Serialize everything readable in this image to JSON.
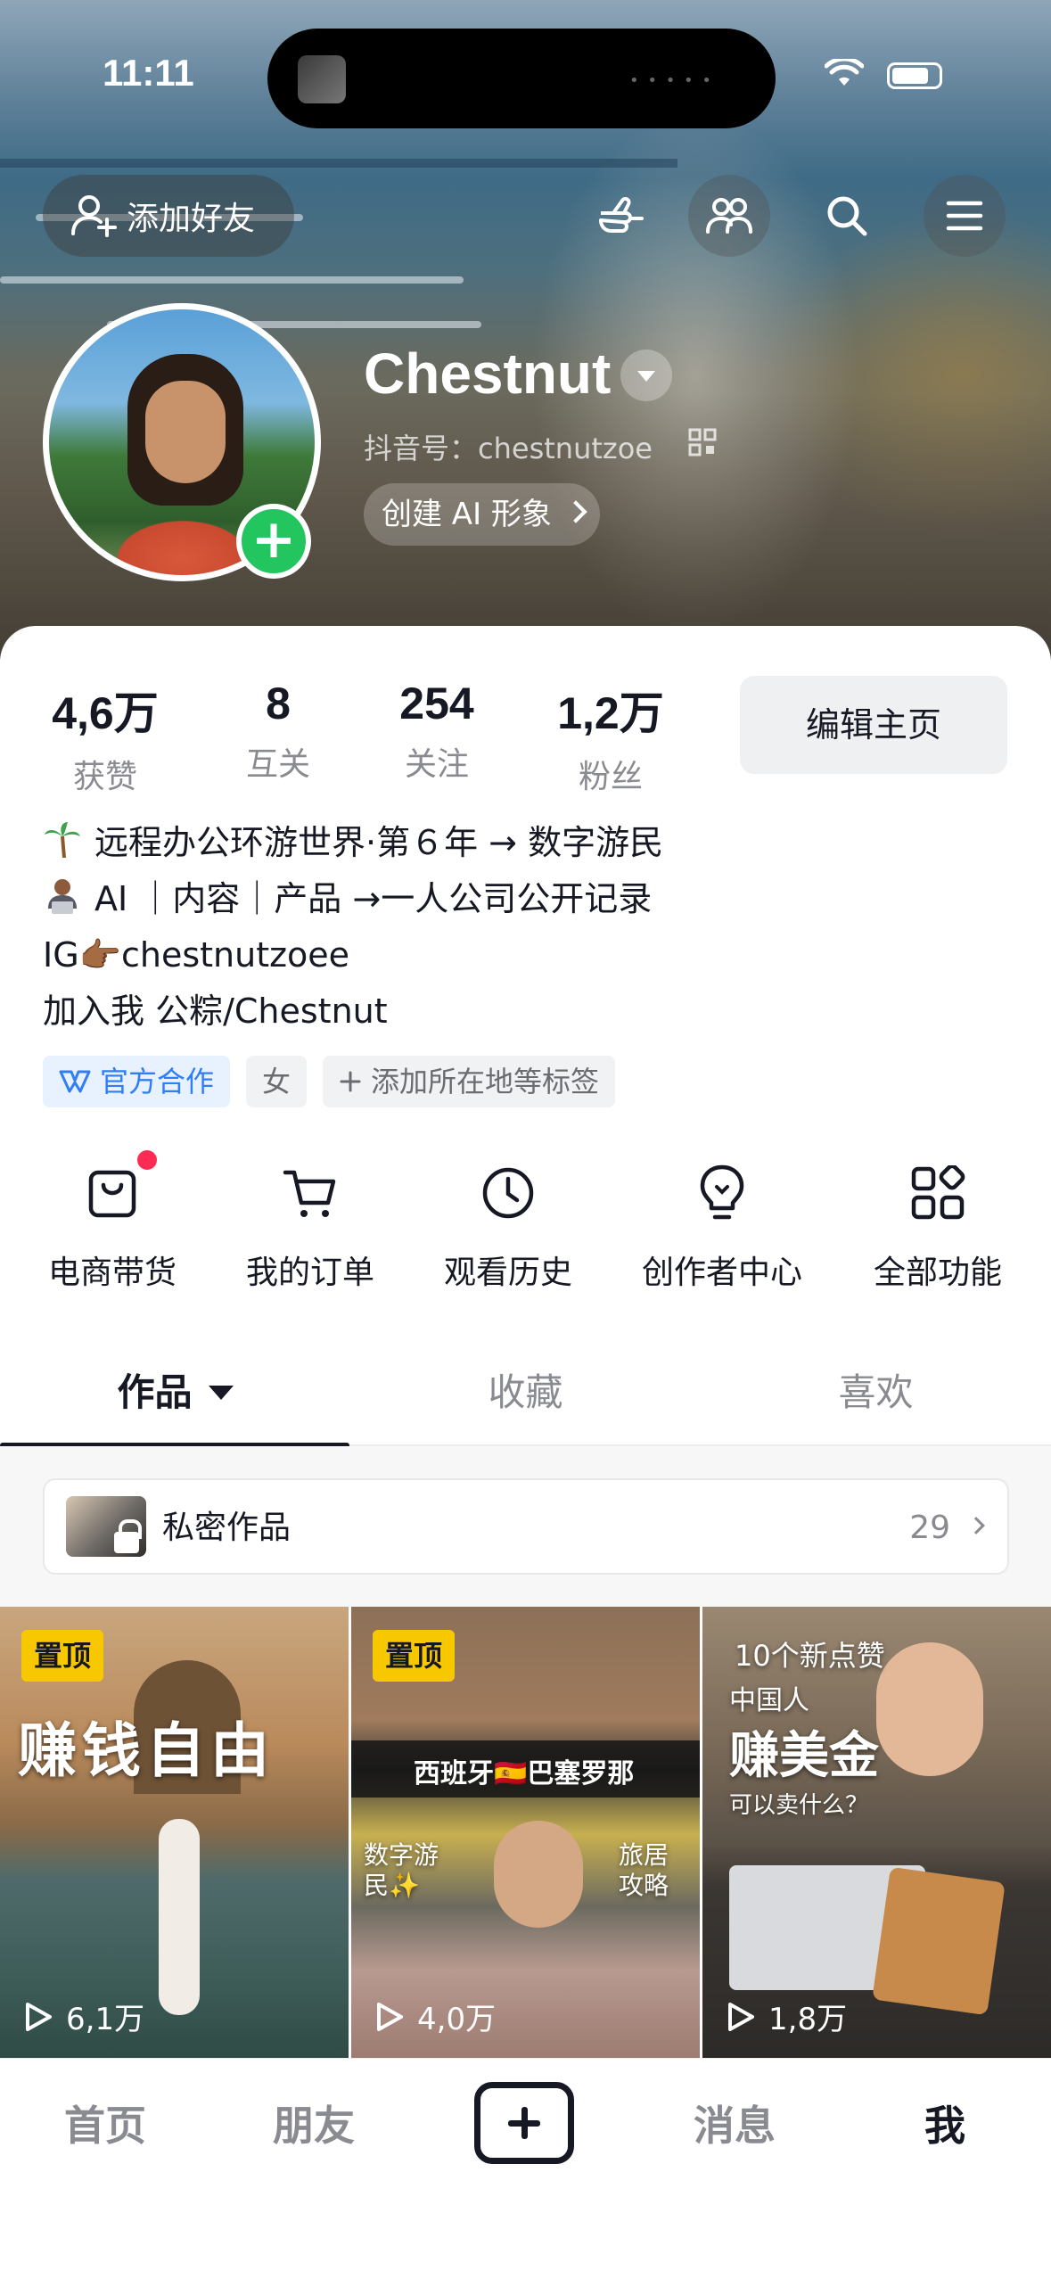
{
  "status_bar": {
    "time": "11:11"
  },
  "top_bar": {
    "add_friend_label": "添加好友"
  },
  "profile": {
    "nickname": "Chestnut",
    "douyin_id": "抖音号：chestnutzoe",
    "ai_avatar_label": "创建 AI 形象"
  },
  "stats": [
    {
      "value": "4,6万",
      "label": "获赞"
    },
    {
      "value": "8",
      "label": "互关"
    },
    {
      "value": "254",
      "label": "关注"
    },
    {
      "value": "1,2万",
      "label": "粉丝"
    }
  ],
  "edit_button_label": "编辑主页",
  "bio": {
    "line1": "远程办公环游世界·第６年 → 数字游民",
    "line2": "AI ｜内容｜产品 →一人公司公开记录",
    "line3": "IG👉🏾chestnutzoee",
    "line4": "加入我 公粽/Chestnut"
  },
  "tags": {
    "official": "官方合作",
    "gender": "女",
    "add_location": "添加所在地等标签"
  },
  "shortcuts": [
    {
      "label": "电商带货",
      "icon": "shopping-bag-icon"
    },
    {
      "label": "我的订单",
      "icon": "cart-icon"
    },
    {
      "label": "观看历史",
      "icon": "clock-icon"
    },
    {
      "label": "创作者中心",
      "icon": "lightbulb-icon"
    },
    {
      "label": "全部功能",
      "icon": "grid-icon"
    }
  ],
  "tabs": [
    {
      "label": "作品"
    },
    {
      "label": "收藏"
    },
    {
      "label": "喜欢"
    }
  ],
  "private_works": {
    "label": "私密作品",
    "count": "29"
  },
  "videos": [
    {
      "pinned": "置顶",
      "title": "赚钱自由",
      "views": "6,1万"
    },
    {
      "pinned": "置顶",
      "title": "西班牙🇪🇸巴塞罗那",
      "caption_left": "数字游民✨",
      "caption_right": "旅居攻略",
      "views": "4,0万"
    },
    {
      "badge": "10个新点赞",
      "caption_top": "中国人",
      "title": "赚美金",
      "caption_bottom": "可以卖什么？",
      "views": "1,8万"
    }
  ],
  "bottom_nav": [
    {
      "label": "首页"
    },
    {
      "label": "朋友"
    },
    {
      "label": "消息"
    },
    {
      "label": "我"
    }
  ],
  "colors": {
    "accent_green": "#23c55e",
    "pin_yellow": "#f7c800",
    "red_dot": "#fe2c55",
    "official_blue": "#2f7ef5"
  }
}
